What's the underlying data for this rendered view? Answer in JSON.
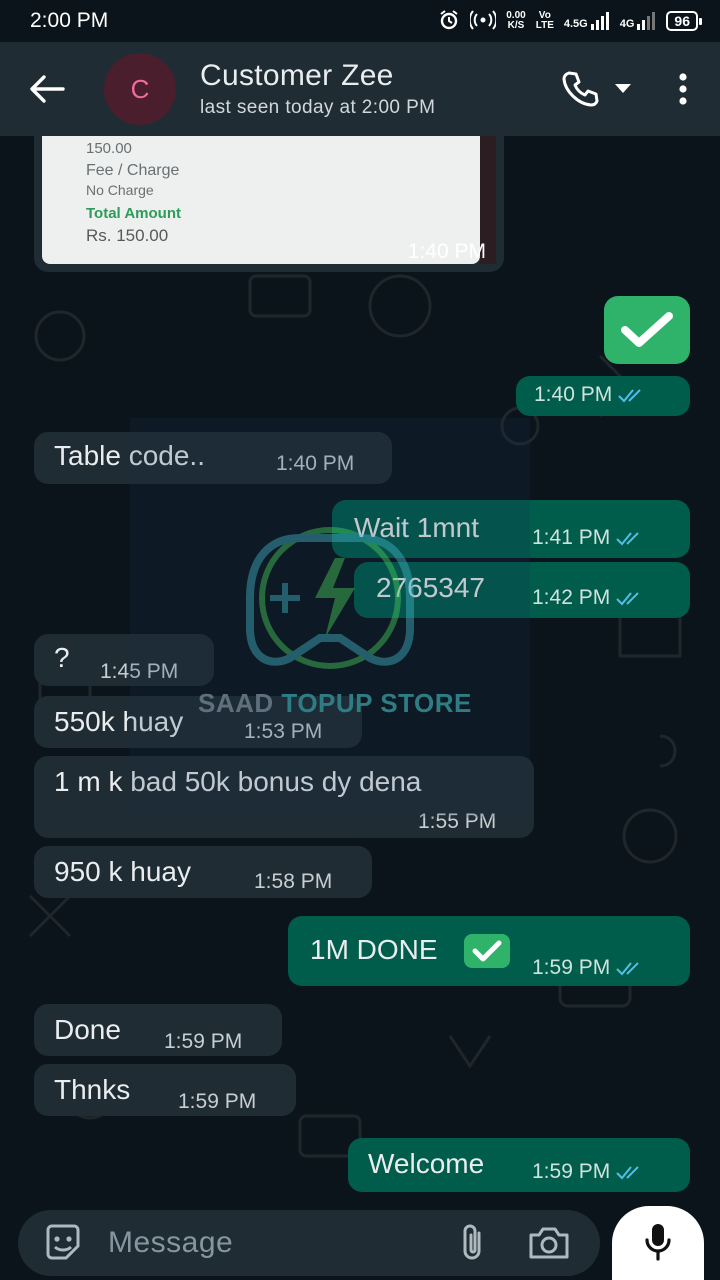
{
  "status_bar": {
    "time": "2:00 PM",
    "net_speed": "0.00",
    "net_unit": "K/S",
    "volte": "Vo",
    "lte": "LTE",
    "sim1": "4.5G",
    "sim2": "4G",
    "battery": "96"
  },
  "header": {
    "avatar_letter": "C",
    "contact_name": "Customer Zee",
    "last_seen": "last seen today at 2:00 PM"
  },
  "receipt": {
    "line1": "150.00",
    "fee_label": "Fee / Charge",
    "fee_value": "No Charge",
    "total_label": "Total Amount",
    "total_value": "Rs. 150.00",
    "time": "1:40 PM"
  },
  "messages": [
    {
      "dir": "out",
      "text": "",
      "emoji": "check",
      "time": "1:40 PM"
    },
    {
      "dir": "in",
      "text": "Table code..",
      "time": "1:40 PM"
    },
    {
      "dir": "out",
      "text": "Wait 1mnt",
      "time": "1:41 PM"
    },
    {
      "dir": "out",
      "text": "2765347",
      "time": "1:42 PM"
    },
    {
      "dir": "in",
      "text": "?",
      "time": "1:45 PM"
    },
    {
      "dir": "in",
      "text": "550k huay",
      "time": "1:53 PM"
    },
    {
      "dir": "in",
      "text": "1 m k bad 50k bonus dy dena",
      "time": "1:55 PM"
    },
    {
      "dir": "in",
      "text": "950 k huay",
      "time": "1:58 PM"
    },
    {
      "dir": "out",
      "text": "1M DONE",
      "emoji": "check",
      "time": "1:59 PM"
    },
    {
      "dir": "in",
      "text": "Done",
      "time": "1:59 PM"
    },
    {
      "dir": "in",
      "text": "Thnks",
      "time": "1:59 PM"
    },
    {
      "dir": "out",
      "text": "Welcome",
      "time": "1:59 PM"
    }
  ],
  "watermark": {
    "part1": "SAAD",
    "part2": "TOPUP STORE"
  },
  "input": {
    "placeholder": "Message"
  },
  "colors": {
    "incoming": "#202c33",
    "outgoing": "#005c4b",
    "tick_read": "#53bdeb",
    "header": "#1f2c34",
    "background": "#0b141a"
  },
  "icons": [
    "back-arrow-icon",
    "phone-icon",
    "dropdown-icon",
    "more-vert-icon",
    "sticker-icon",
    "attach-icon",
    "camera-icon",
    "mic-icon"
  ]
}
